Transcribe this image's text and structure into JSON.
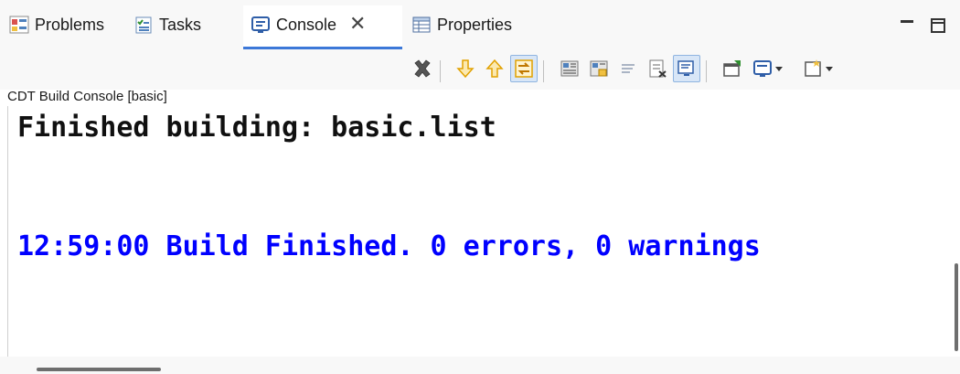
{
  "tabs": [
    {
      "label": "Problems",
      "icon": "problems-icon",
      "active": false
    },
    {
      "label": "Tasks",
      "icon": "tasks-icon",
      "active": false
    },
    {
      "label": "Console",
      "icon": "console-icon",
      "active": true,
      "closable": true
    },
    {
      "label": "Properties",
      "icon": "properties-icon",
      "active": false
    }
  ],
  "view_controls": [
    "minimize-icon",
    "maximize-icon"
  ],
  "toolbar": {
    "buttons": [
      {
        "name": "clear-console",
        "icon": "remove-all-icon"
      },
      {
        "name": "next-error",
        "icon": "arrow-down-icon"
      },
      {
        "name": "previous-error",
        "icon": "arrow-up-icon"
      },
      {
        "name": "link-with-editor",
        "icon": "link-icon",
        "pressed": true
      },
      {
        "name": "copy-build-log",
        "icon": "save-log-icon"
      },
      {
        "name": "scroll-lock",
        "icon": "lock-icon"
      },
      {
        "name": "word-wrap",
        "icon": "wrap-icon"
      },
      {
        "name": "clear",
        "icon": "clear-icon"
      },
      {
        "name": "show-console",
        "icon": "monitor-icon",
        "pressed": true
      },
      {
        "name": "pin-console",
        "icon": "pin-icon"
      },
      {
        "name": "display-selected-console",
        "icon": "console-dropdown-icon"
      },
      {
        "name": "open-console",
        "icon": "new-console-icon"
      }
    ]
  },
  "console": {
    "name": "CDT Build Console [basic]",
    "lines": [
      {
        "text": "Finished building: basic.list",
        "color": "#101010"
      },
      {
        "text": "12:59:00 Build Finished. 0 errors, 0 warnings",
        "color": "#0000ff"
      }
    ]
  },
  "colors": {
    "accent": "#0000ff",
    "tab_active_underline": "#3c78d8",
    "toolbar_pressed": "#d8e6f7"
  }
}
